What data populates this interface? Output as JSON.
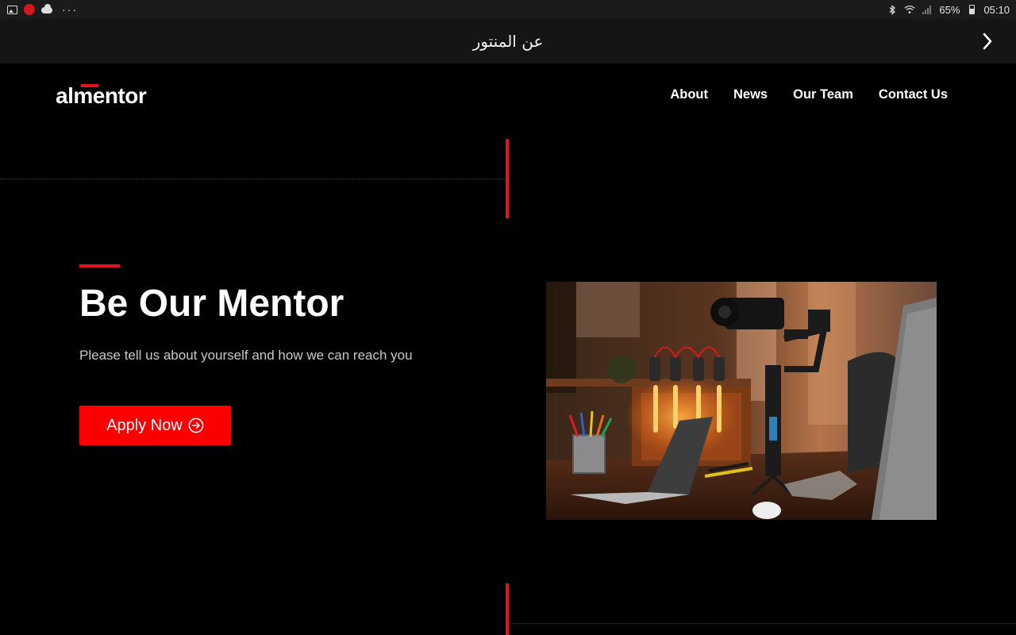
{
  "status_bar": {
    "battery": "65%",
    "time": "05:10",
    "more": "···"
  },
  "browser": {
    "title": "عن المنتور",
    "next_icon": "chevron-right-icon"
  },
  "header": {
    "logo_text": "almentor",
    "nav": [
      "About",
      "News",
      "Our Team",
      "Contact Us"
    ]
  },
  "hero": {
    "title": "Be Our Mentor",
    "subtitle": "Please tell us about yourself and how we can reach you",
    "cta_label": "Apply Now",
    "cta_icon": "arrow-right-circle-icon"
  },
  "colors": {
    "background": "#000000",
    "accent": "#e3121b",
    "button": "#fa0000",
    "subtitle": "#c8c8c8",
    "title_bar": "#151515",
    "status_bar": "#1b1b1b"
  }
}
